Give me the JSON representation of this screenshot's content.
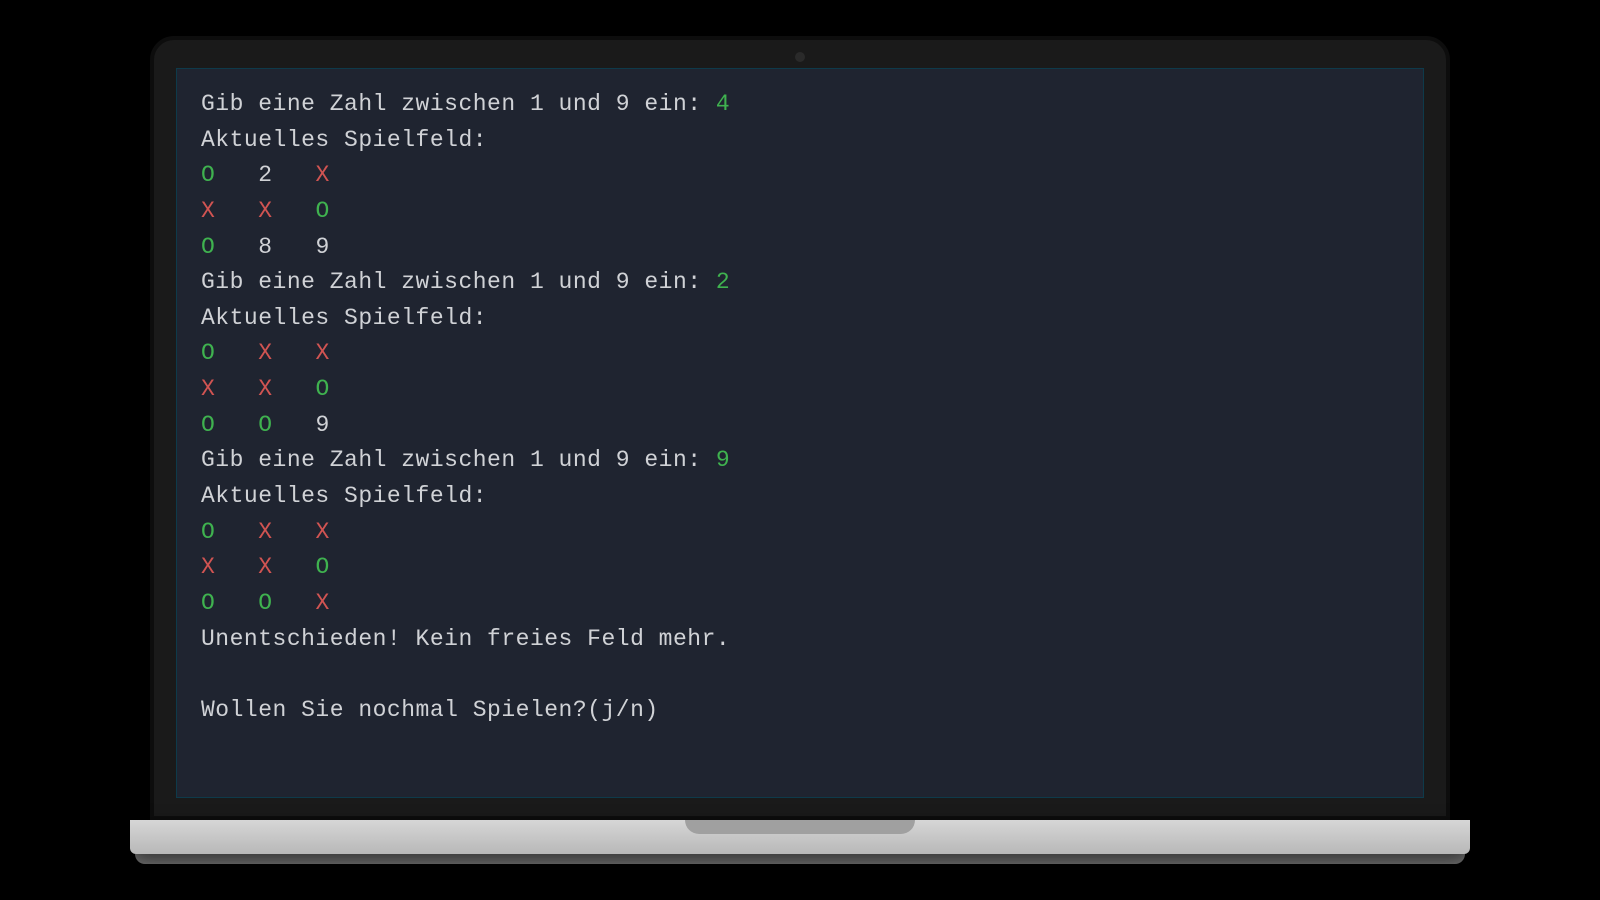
{
  "prompt_text": "Gib eine Zahl zwischen 1 und 9 ein: ",
  "board_header": "Aktuelles Spielfeld:",
  "cell_separator": "   ",
  "turns": [
    {
      "input": "4",
      "board": [
        [
          "O",
          "2",
          "X"
        ],
        [
          "X",
          "X",
          "O"
        ],
        [
          "O",
          "8",
          "9"
        ]
      ]
    },
    {
      "input": "2",
      "board": [
        [
          "O",
          "X",
          "X"
        ],
        [
          "X",
          "X",
          "O"
        ],
        [
          "O",
          "O",
          "9"
        ]
      ]
    },
    {
      "input": "9",
      "board": [
        [
          "O",
          "X",
          "X"
        ],
        [
          "X",
          "X",
          "O"
        ],
        [
          "O",
          "O",
          "X"
        ]
      ]
    }
  ],
  "result_message": "Unentschieden! Kein freies Feld mehr.",
  "replay_prompt": "Wollen Sie nochmal Spielen?(j/n)"
}
